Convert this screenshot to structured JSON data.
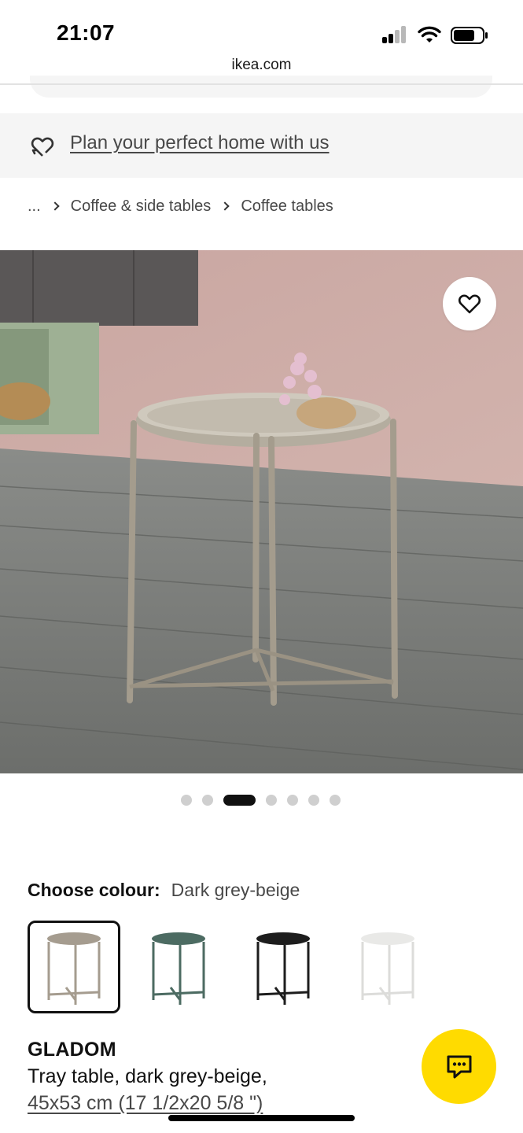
{
  "status_bar": {
    "time": "21:07"
  },
  "browser": {
    "url": "ikea.com"
  },
  "plan_banner": {
    "link_text": "Plan your perfect home with us",
    "icon": "plan-heart-icon"
  },
  "breadcrumb": {
    "ellipsis": "...",
    "items": [
      "Coffee & side tables",
      "Coffee tables"
    ]
  },
  "gallery": {
    "image_count": 7,
    "active_index": 2,
    "favourite_icon": "heart-icon"
  },
  "colour": {
    "label": "Choose colour:",
    "value": "Dark grey-beige",
    "options": [
      {
        "color": "#a59c8f",
        "selected": true
      },
      {
        "color": "#4c6b62",
        "selected": false
      },
      {
        "color": "#1d1d1d",
        "selected": false
      },
      {
        "color": "#e9e9e7",
        "selected": false
      }
    ]
  },
  "product": {
    "name": "GLADOM",
    "description": "Tray table, dark grey-beige,",
    "size": "45x53 cm (17 1/2x20 5/8 \")"
  },
  "chat": {
    "icon": "chat-icon",
    "accent": "#ffdb00"
  }
}
